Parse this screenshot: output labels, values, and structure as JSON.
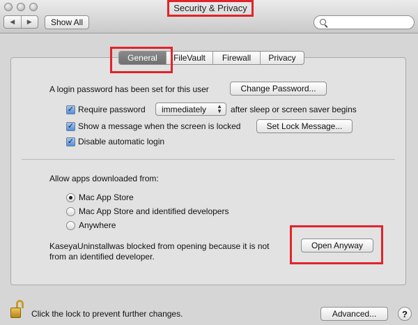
{
  "window": {
    "title": "Security & Privacy"
  },
  "toolbar": {
    "back": "◀",
    "forward": "▶",
    "show_all": "Show All",
    "search_placeholder": ""
  },
  "tabs": [
    {
      "label": "General",
      "active": true
    },
    {
      "label": "FileVault",
      "active": false
    },
    {
      "label": "Firewall",
      "active": false
    },
    {
      "label": "Privacy",
      "active": false
    }
  ],
  "general": {
    "login_password_text": "A login password has been set for this user",
    "change_password_button": "Change Password...",
    "require_password": {
      "label": "Require password",
      "checked": true,
      "selected": "immediately",
      "suffix": "after sleep or screen saver begins"
    },
    "show_message": {
      "label": "Show a message when the screen is locked",
      "checked": true,
      "button": "Set Lock Message..."
    },
    "disable_login": {
      "label": "Disable automatic login",
      "checked": true
    }
  },
  "apps": {
    "heading": "Allow apps downloaded from:",
    "options": [
      {
        "label": "Mac App Store",
        "selected": true
      },
      {
        "label": "Mac App Store and identified developers",
        "selected": false
      },
      {
        "label": "Anywhere",
        "selected": false
      }
    ],
    "blocked_app": "KaseyaUninstall",
    "blocked_line1": "was blocked from opening because it is not",
    "blocked_line2": "from an identified developer.",
    "open_anyway_button": "Open Anyway"
  },
  "footer": {
    "lock_text": "Click the lock to prevent further changes.",
    "advanced_button": "Advanced...",
    "help": "?"
  },
  "colors": {
    "highlight": "#e0242b",
    "checkbox": "#4f8fde",
    "active_tab": "#7a7a7a"
  }
}
